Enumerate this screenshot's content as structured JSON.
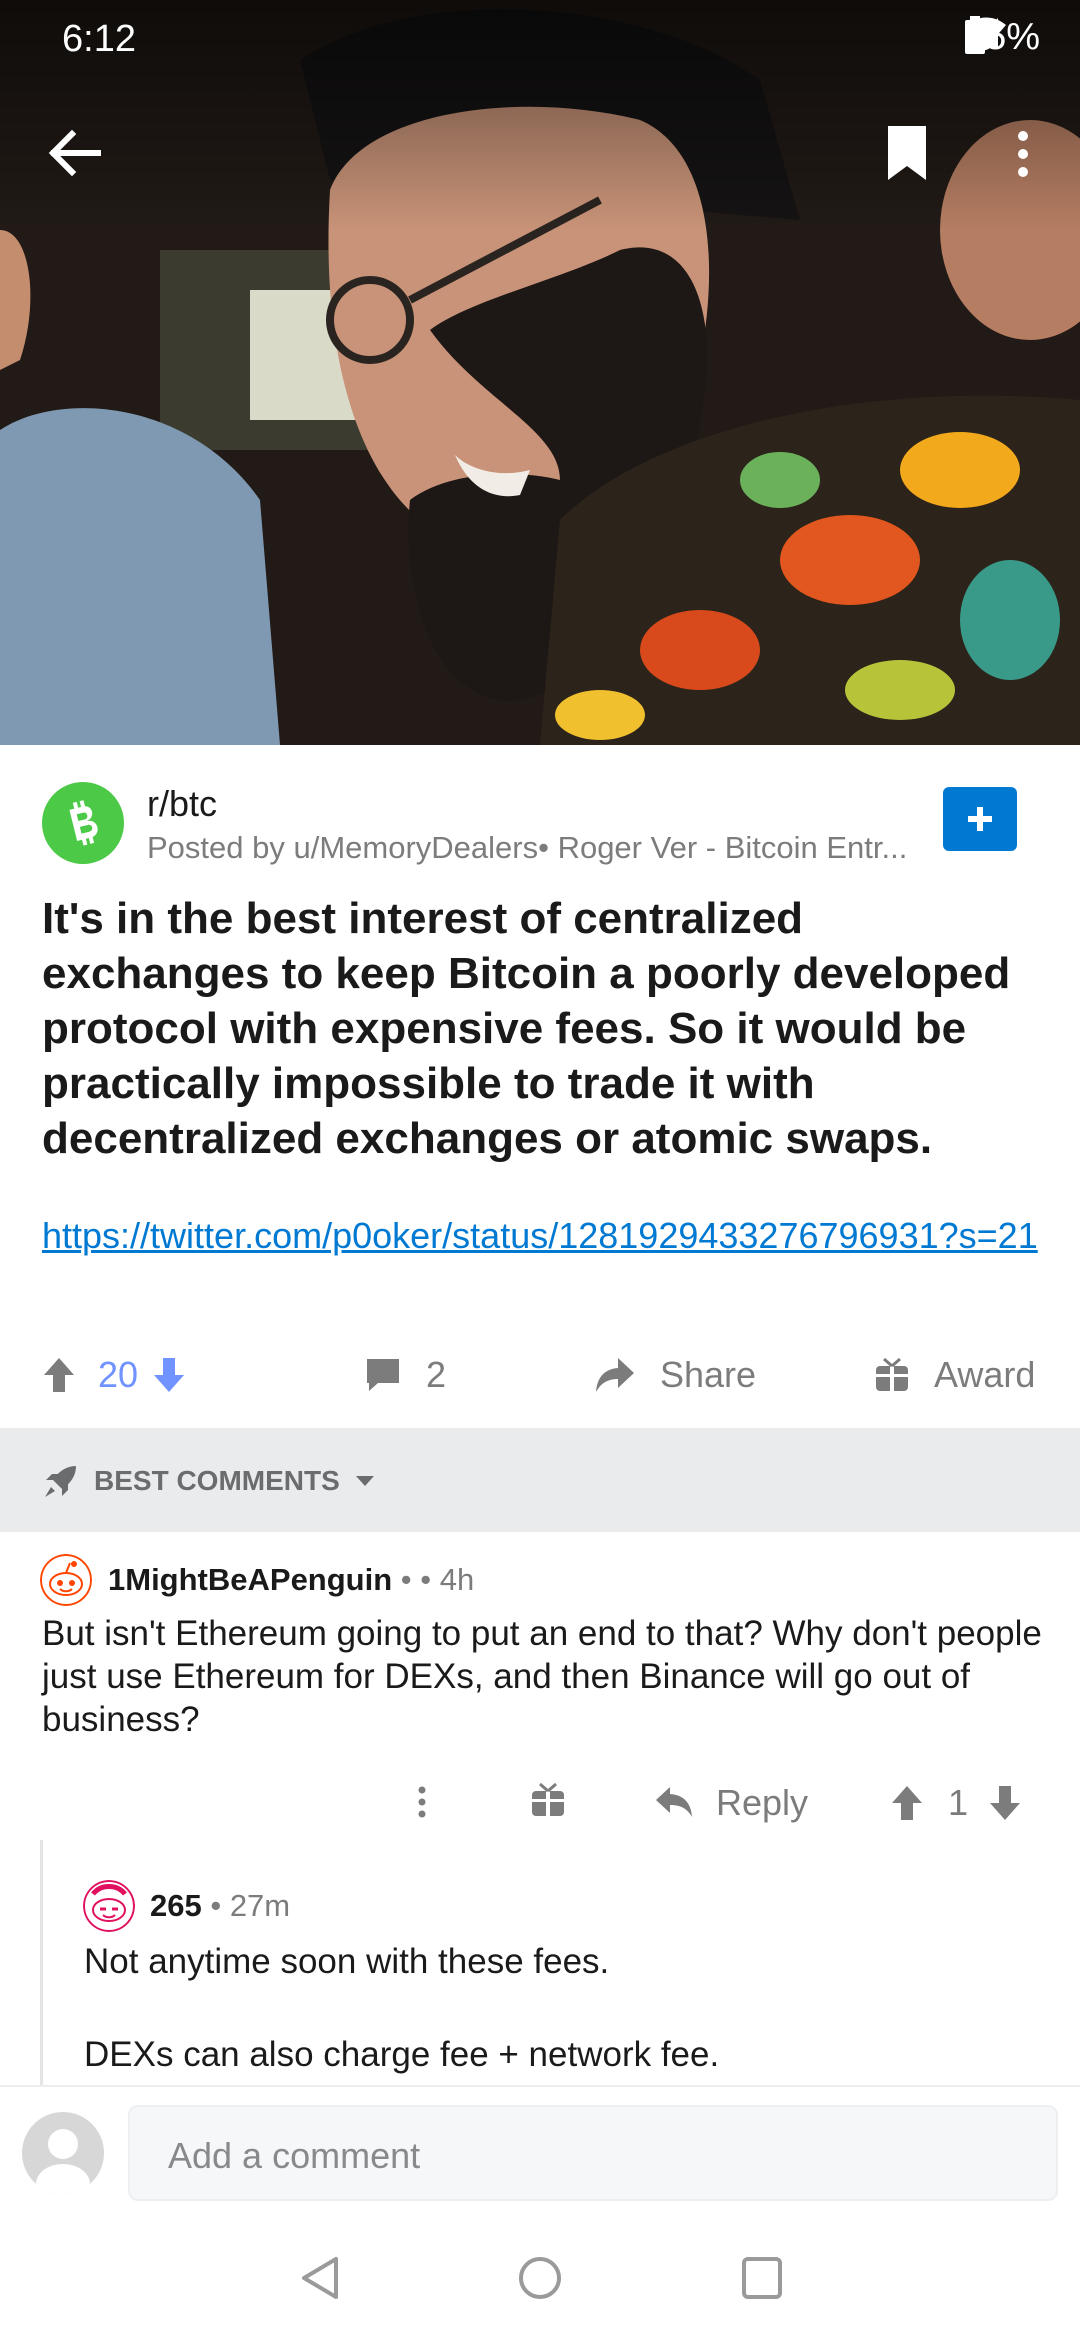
{
  "status_bar": {
    "time": "6:12",
    "battery": "75%"
  },
  "post": {
    "subreddit": "r/btc",
    "posted_by": "Posted by u/MemoryDealers• Roger Ver - Bitcoin Entr...",
    "title": "It's in the best interest of centralized exchanges to keep Bitcoin a poorly developed protocol with expensive fees. So it would be practically impossible to trade it with decentralized exchanges or atomic swaps.",
    "link": "https://twitter.com/p0oker/status/1281929433276796931?s=21",
    "votes": "20",
    "comments": "2",
    "share_label": "Share",
    "award_label": "Award"
  },
  "sort": {
    "label": "BEST COMMENTS"
  },
  "comments": [
    {
      "author": "1MightBeAPenguin",
      "meta": " • • 4h",
      "body": "But isn't Ethereum going to put an end to that? Why don't people just use Ethereum for DEXs, and then Binance will go out of business?",
      "reply_label": "Reply",
      "votes": "1"
    },
    {
      "author": "265",
      "meta": " • 27m",
      "body_line1": "Not anytime soon with these fees.",
      "body_line2": "DEXs can also charge fee + network fee."
    }
  ],
  "composer": {
    "placeholder": "Add a comment"
  },
  "colors": {
    "accent": "#0079d3",
    "upvote": "#7193ff",
    "sort_bg": "#eaebec"
  }
}
